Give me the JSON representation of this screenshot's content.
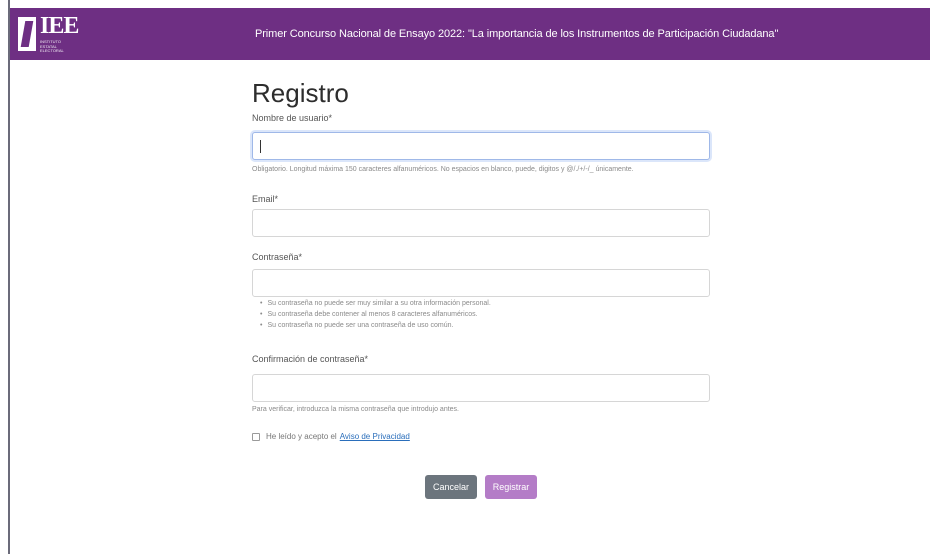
{
  "header": {
    "logo_text": "IEE",
    "logo_subtext": "INSTITUTO ESTATAL ELECTORAL",
    "title": "Primer Concurso Nacional de Ensayo 2022: \"La importancia de los Instrumentos de Participación Ciudadana\""
  },
  "form": {
    "title": "Registro",
    "username": {
      "label": "Nombre de usuario*",
      "value": "",
      "help": "Obligatorio. Longitud máxima 150 caracteres alfanuméricos. No espacios en blanco, puede, digitos y @/./+/-/_ únicamente."
    },
    "email": {
      "label": "Email*",
      "value": ""
    },
    "password": {
      "label": "Contraseña*",
      "value": "",
      "rules": [
        "Su contraseña no puede ser muy similar a su otra información personal.",
        "Su contraseña debe contener al menos 8 caracteres alfanuméricos.",
        "Su contraseña no puede ser una contraseña de uso común."
      ]
    },
    "password_confirm": {
      "label": "Confirmación de contraseña*",
      "value": "",
      "help": "Para verificar, introduzca la misma contraseña que introdujo antes."
    },
    "privacy": {
      "checked": false,
      "label": "He leído y acepto el",
      "link": "Aviso de Privacidad"
    },
    "buttons": {
      "cancel": "Cancelar",
      "submit": "Registrar"
    }
  },
  "colors": {
    "header_bg": "#6e2f83",
    "submit_bg": "#b47cc7",
    "cancel_bg": "#6c757d",
    "link": "#2a6ebb"
  }
}
